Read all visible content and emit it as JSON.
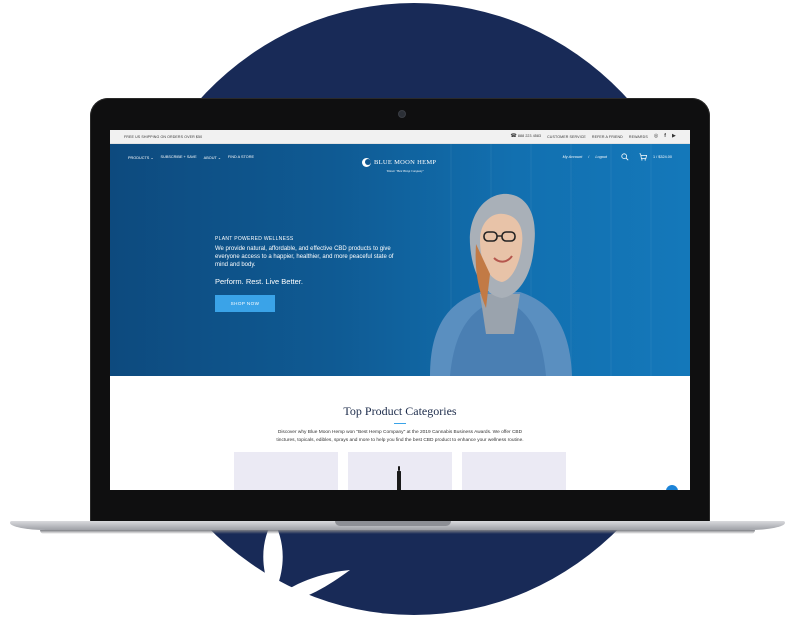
{
  "colors": {
    "backdrop_circle": "#182a57",
    "hero_blue": "#1270b0",
    "accent": "#3aa3e8",
    "heading": "#1c2b4a",
    "card": "#ebeaf4"
  },
  "topbar": {
    "promo": "FREE US SHIPPING ON ORDERS OVER $50",
    "phone_icon": "phone-icon",
    "phone": "888 223 4583",
    "links": [
      "CUSTOMER SERVICE",
      "REFER A FRIEND",
      "REWARDS"
    ],
    "social_icons": [
      "instagram-icon",
      "facebook-icon",
      "youtube-icon"
    ]
  },
  "nav": {
    "items": [
      "PRODUCTS ⌄",
      "SUBSCRIBE + SAVE",
      "ABOUT ⌄",
      "FIND A STORE"
    ],
    "brand_name": "BLUE MOON HEMP",
    "brand_sub": "Winner \"Best Hemp Company\"",
    "account": "My Account",
    "separator": "/",
    "logout": "Logout",
    "search_icon": "search-icon",
    "cart_icon": "cart-icon",
    "cart_summary": "1 / $324.00"
  },
  "hero": {
    "eyebrow": "PLANT POWERED WELLNESS",
    "lead": "We provide natural, affordable, and effective CBD products to give everyone access to a happier, healthier, and more peaceful state of mind and body.",
    "tagline": "Perform. Rest. Live Better.",
    "cta": "SHOP NOW"
  },
  "categories": {
    "title": "Top Product Categories",
    "description": "Discover why Blue Moon Hemp won \"Best Hemp Company\" at the 2019 Cannabis Business Awards. We offer CBD tinctures, topicals, edibles, sprays and more to help you find the best CBD product to enhance your wellness routine."
  },
  "chat_icon": "chat-icon",
  "decor_icon": "cannabis-leaf-icon"
}
